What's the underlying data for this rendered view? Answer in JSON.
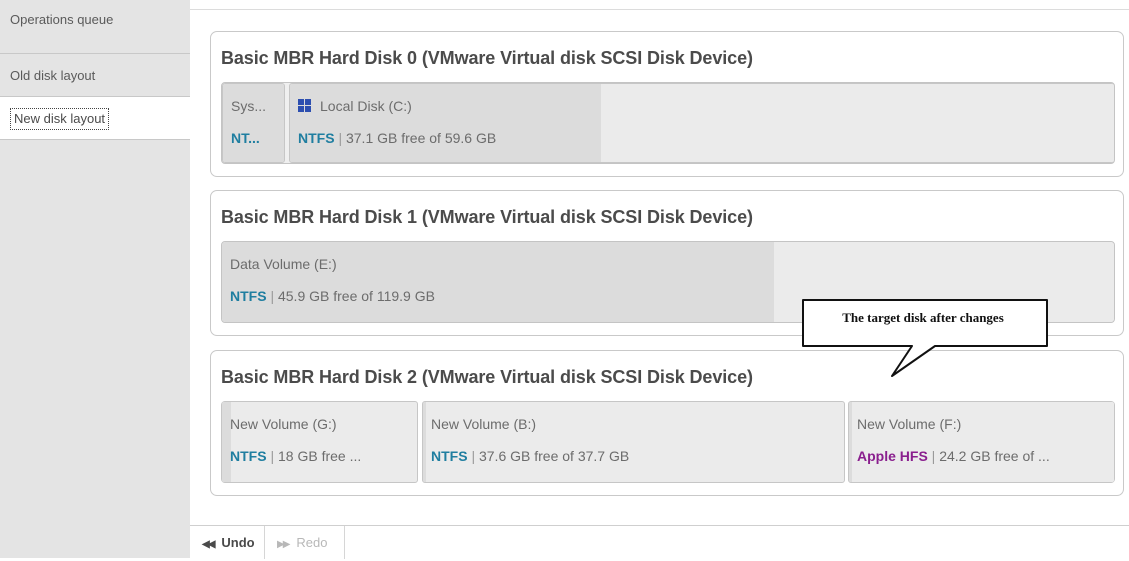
{
  "sidebar": {
    "items": [
      {
        "label": "Operations queue"
      },
      {
        "label": "Old disk layout"
      },
      {
        "label": "New disk layout"
      }
    ]
  },
  "disks": [
    {
      "title": "Basic MBR Hard Disk 0 (VMware Virtual disk SCSI Disk Device)",
      "partitions": [
        {
          "label": "Sys...",
          "fs": "NT...",
          "detail": ""
        },
        {
          "label": "Local Disk (C:)",
          "fs": "NTFS",
          "detail": "37.1 GB free of 59.6 GB",
          "icon": "windows-icon"
        }
      ]
    },
    {
      "title": "Basic MBR Hard Disk 1 (VMware Virtual disk SCSI Disk Device)",
      "partitions": [
        {
          "label": "Data Volume (E:)",
          "fs": "NTFS",
          "detail": "45.9 GB free of 119.9 GB"
        }
      ]
    },
    {
      "title": "Basic MBR Hard Disk 2 (VMware Virtual disk SCSI Disk Device)",
      "partitions": [
        {
          "label": "New Volume (G:)",
          "fs": "NTFS",
          "detail": "18 GB free ..."
        },
        {
          "label": "New Volume (B:)",
          "fs": "NTFS",
          "detail": "37.6 GB free of 37.7 GB"
        },
        {
          "label": "New Volume (F:)",
          "fs": "Apple HFS",
          "detail": "24.2 GB free of ..."
        }
      ]
    }
  ],
  "separator": "|",
  "callout": {
    "text": "The target disk after changes"
  },
  "toolbar": {
    "undo_label": "Undo",
    "redo_label": "Redo",
    "undo_icon": "rewind-icon",
    "redo_icon": "fast-forward-icon"
  },
  "colors": {
    "ntfs": "#1f7ea0",
    "apple_hfs": "#8a1f8e",
    "windows_icon": "#2d4fb0"
  }
}
